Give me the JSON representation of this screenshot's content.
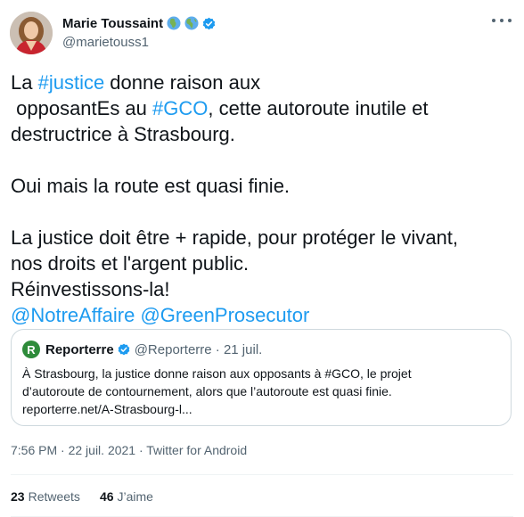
{
  "author": {
    "name": "Marie Toussaint",
    "handle": "@marietouss1"
  },
  "tweet": {
    "line1_pre": "La ",
    "tag_justice": "#justice",
    "line1_post": " donne raison aux",
    "line2_pre": " opposantEs au ",
    "tag_gco": "#GCO",
    "line2_post": ", cette autoroute inutile et",
    "line3": "destructrice à Strasbourg.",
    "line4": "Oui mais la route est quasi finie.",
    "line5": "La justice doit être + rapide, pour protéger le vivant,",
    "line6": "nos droits et l'argent public.",
    "line7": "Réinvestissons-la!",
    "mention1": "@NotreAffaire",
    "mention2": "@GreenProsecutor"
  },
  "quote": {
    "logo_letter": "R",
    "name": "Reporterre",
    "handle_date": "@Reporterre · 21 juil.",
    "line1": "À Strasbourg, la justice donne raison aux opposants à #GCO, le projet",
    "line2": "d’autoroute de contournement, alors que l’autoroute est quasi finie.",
    "line3": "reporterre.net/A-Strasbourg-l..."
  },
  "meta": {
    "time": "7:56 PM · 22 juil. 2021 · ",
    "source": "Twitter for Android"
  },
  "stats": {
    "retweets_count": "23",
    "retweets_label": "Retweets",
    "likes_count": "46",
    "likes_label": "J’aime"
  },
  "colors": {
    "link": "#1d9bf0",
    "verified": "#1d9bf0",
    "muted": "#536471",
    "reporterre_green": "#2e8b3a"
  },
  "icons": {
    "globe_1": "globe-africa-icon",
    "globe_2": "globe-americas-icon",
    "verified": "verified-badge-icon",
    "more": "more-options-icon"
  }
}
